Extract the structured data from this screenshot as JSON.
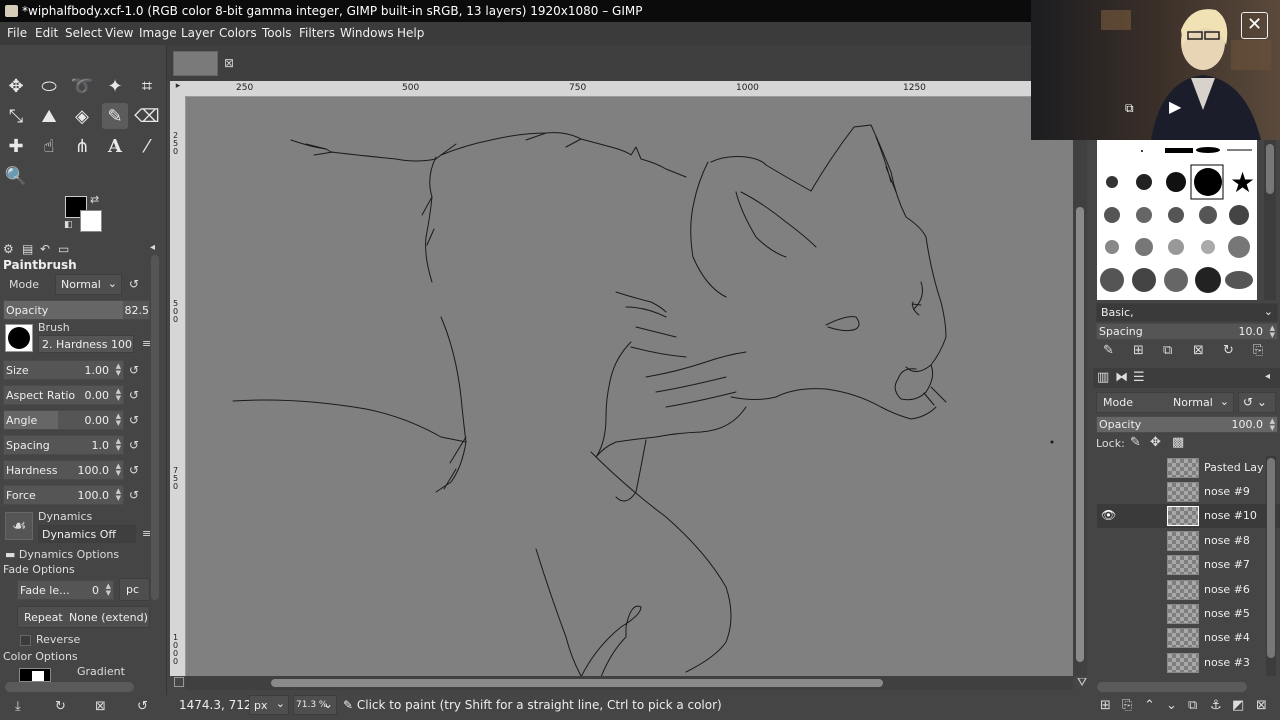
{
  "window": {
    "title": "*wiphalfbody.xcf-1.0 (RGB color 8-bit gamma integer, GIMP built-in sRGB, 13 layers) 1920x1080 – GIMP"
  },
  "menu": [
    "File",
    "Edit",
    "Select",
    "View",
    "Image",
    "Layer",
    "Colors",
    "Tools",
    "Filters",
    "Windows",
    "Help"
  ],
  "tool_options": {
    "title": "Paintbrush",
    "mode_label": "Mode",
    "mode_value": "Normal",
    "opacity_label": "Opacity",
    "opacity_value": "82.5",
    "brush_label": "Brush",
    "brush_name": "2. Hardness 100",
    "size_label": "Size",
    "size_value": "1.00",
    "aspect_label": "Aspect Ratio",
    "aspect_value": "0.00",
    "angle_label": "Angle",
    "angle_value": "0.00",
    "spacing_label": "Spacing",
    "spacing_value": "1.0",
    "hardness_label": "Hardness",
    "hardness_value": "100.0",
    "force_label": "Force",
    "force_value": "100.0",
    "dynamics_label": "Dynamics",
    "dynamics_value": "Dynamics Off",
    "dynamics_options": "Dynamics Options",
    "fade_options": "Fade Options",
    "fade_length_label": "Fade le...",
    "fade_length_value": "0",
    "fade_unit": "pc",
    "repeat_label": "Repeat",
    "repeat_value": "None (extend)",
    "reverse_label": "Reverse",
    "color_options": "Color Options",
    "gradient_label": "Gradient"
  },
  "rulers": {
    "h_ticks": [
      "250",
      "500",
      "750",
      "1000",
      "1250"
    ],
    "v_ticks": [
      "250",
      "500",
      "750",
      "1000"
    ]
  },
  "status": {
    "coords": "1474.3, 712.6",
    "unit": "px",
    "zoom": "71.3 %",
    "message": "Click to paint (try Shift for a straight line, Ctrl to pick a color)"
  },
  "brushes_panel": {
    "preset_value": "Basic,",
    "spacing_label": "Spacing",
    "spacing_value": "10.0"
  },
  "layers_panel": {
    "mode_label": "Mode",
    "mode_value": "Normal",
    "opacity_label": "Opacity",
    "opacity_value": "100.0",
    "lock_label": "Lock:",
    "layers": [
      {
        "name": "Pasted Lay",
        "visible": false,
        "selected": false
      },
      {
        "name": "nose #9",
        "visible": false,
        "selected": false
      },
      {
        "name": "nose #10",
        "visible": true,
        "selected": true
      },
      {
        "name": "nose #8",
        "visible": false,
        "selected": false
      },
      {
        "name": "nose #7",
        "visible": false,
        "selected": false
      },
      {
        "name": "nose #6",
        "visible": false,
        "selected": false
      },
      {
        "name": "nose #5",
        "visible": false,
        "selected": false
      },
      {
        "name": "nose #4",
        "visible": false,
        "selected": false
      },
      {
        "name": "nose #3",
        "visible": false,
        "selected": false
      }
    ]
  },
  "icons": {
    "close": "✕",
    "play": "▶",
    "eye": "👁"
  }
}
